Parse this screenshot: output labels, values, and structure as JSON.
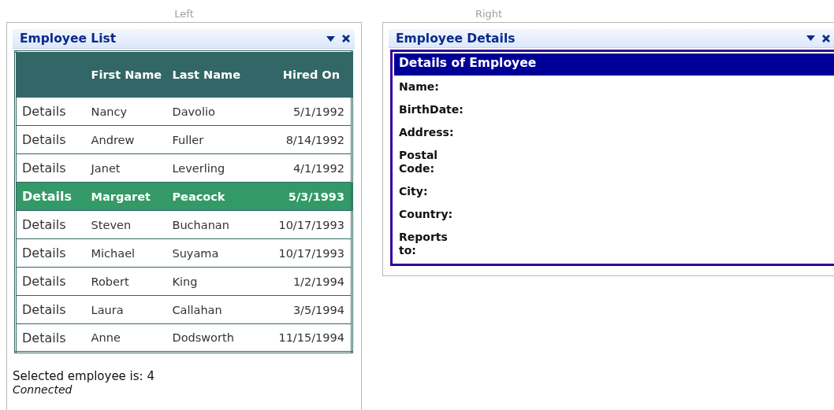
{
  "zones": [
    {
      "label": "Left"
    },
    {
      "label": "Right"
    }
  ],
  "employee_list": {
    "title": "Employee List",
    "columns": [
      {},
      {
        "label": "First Name"
      },
      {
        "label": "Last Name"
      },
      {
        "label": "Hired On"
      }
    ],
    "rows": [
      {
        "link": "Details",
        "first_name": "Nancy",
        "last_name": "Davolio",
        "hired_on": "5/1/1992",
        "selected": false
      },
      {
        "link": "Details",
        "first_name": "Andrew",
        "last_name": "Fuller",
        "hired_on": "8/14/1992",
        "selected": false
      },
      {
        "link": "Details",
        "first_name": "Janet",
        "last_name": "Leverling",
        "hired_on": "4/1/1992",
        "selected": false
      },
      {
        "link": "Details",
        "first_name": "Margaret",
        "last_name": "Peacock",
        "hired_on": "5/3/1993",
        "selected": true
      },
      {
        "link": "Details",
        "first_name": "Steven",
        "last_name": "Buchanan",
        "hired_on": "10/17/1993",
        "selected": false
      },
      {
        "link": "Details",
        "first_name": "Michael",
        "last_name": "Suyama",
        "hired_on": "10/17/1993",
        "selected": false
      },
      {
        "link": "Details",
        "first_name": "Robert",
        "last_name": "King",
        "hired_on": "1/2/1994",
        "selected": false
      },
      {
        "link": "Details",
        "first_name": "Laura",
        "last_name": "Callahan",
        "hired_on": "3/5/1994",
        "selected": false
      },
      {
        "link": "Details",
        "first_name": "Anne",
        "last_name": "Dodsworth",
        "hired_on": "11/15/1994",
        "selected": false
      }
    ],
    "selection_text": "Selected employee is: 4",
    "status": "Connected"
  },
  "employee_details": {
    "title": "Employee Details",
    "header": "Details of Employee",
    "fields": [
      {
        "label": "Name:"
      },
      {
        "label": "BirthDate:"
      },
      {
        "label": "Address:"
      },
      {
        "label": "Postal Code:"
      },
      {
        "label": "City:"
      },
      {
        "label": "Country:"
      },
      {
        "label": "Reports to:"
      }
    ]
  }
}
